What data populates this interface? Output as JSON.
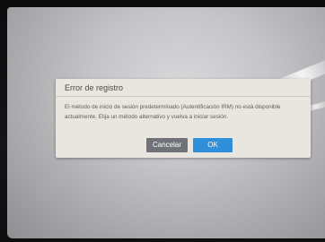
{
  "dialog": {
    "title": "Error de registro",
    "message": "El método de inicio de sesión predeterminado (Autentificación IRM) no está disponible actualmente. Elija un método alternativo y vuelva a iniciar sesión.",
    "cancel_label": "Cancelar",
    "ok_label": "OK"
  },
  "colors": {
    "dialog_background": "#e9e6df",
    "cancel_button": "#6f7276",
    "ok_button": "#2f8fd8"
  }
}
